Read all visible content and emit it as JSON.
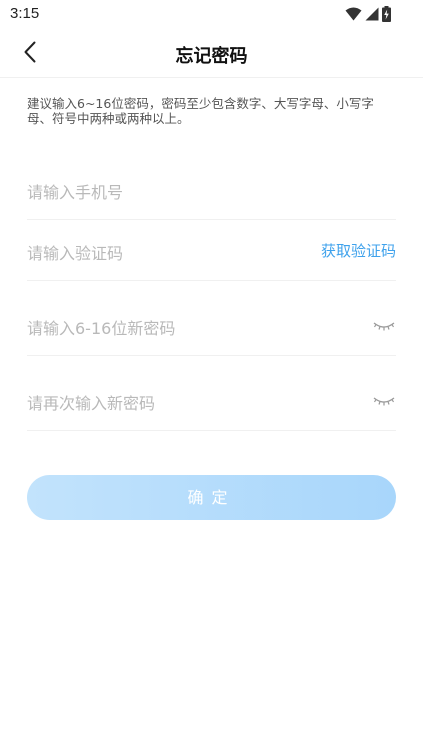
{
  "status_bar": {
    "time": "3:15",
    "icons": [
      "wifi-icon",
      "signal-icon",
      "battery-charging-icon"
    ]
  },
  "header": {
    "title": "忘记密码",
    "back_icon": "chevron-left-icon"
  },
  "hint": {
    "text": "建议输入6~16位密码，密码至少包含数字、大写字母、小写字母、符号中两种或两种以上。"
  },
  "form": {
    "phone": {
      "placeholder": "请输入手机号",
      "value": ""
    },
    "code": {
      "placeholder": "请输入验证码",
      "value": "",
      "get_code_label": "获取验证码"
    },
    "new_password": {
      "placeholder": "请输入6-16位新密码",
      "value": "",
      "toggle_icon": "eye-closed-icon"
    },
    "confirm_password": {
      "placeholder": "请再次输入新密码",
      "value": "",
      "toggle_icon": "eye-closed-icon"
    }
  },
  "actions": {
    "confirm_label": "确定"
  },
  "colors": {
    "accent": "#3fa2ec",
    "button_start": "#c2e3fc",
    "button_end": "#a8d6fb",
    "placeholder": "#b9b9b9",
    "divider": "#f0f0f0"
  }
}
